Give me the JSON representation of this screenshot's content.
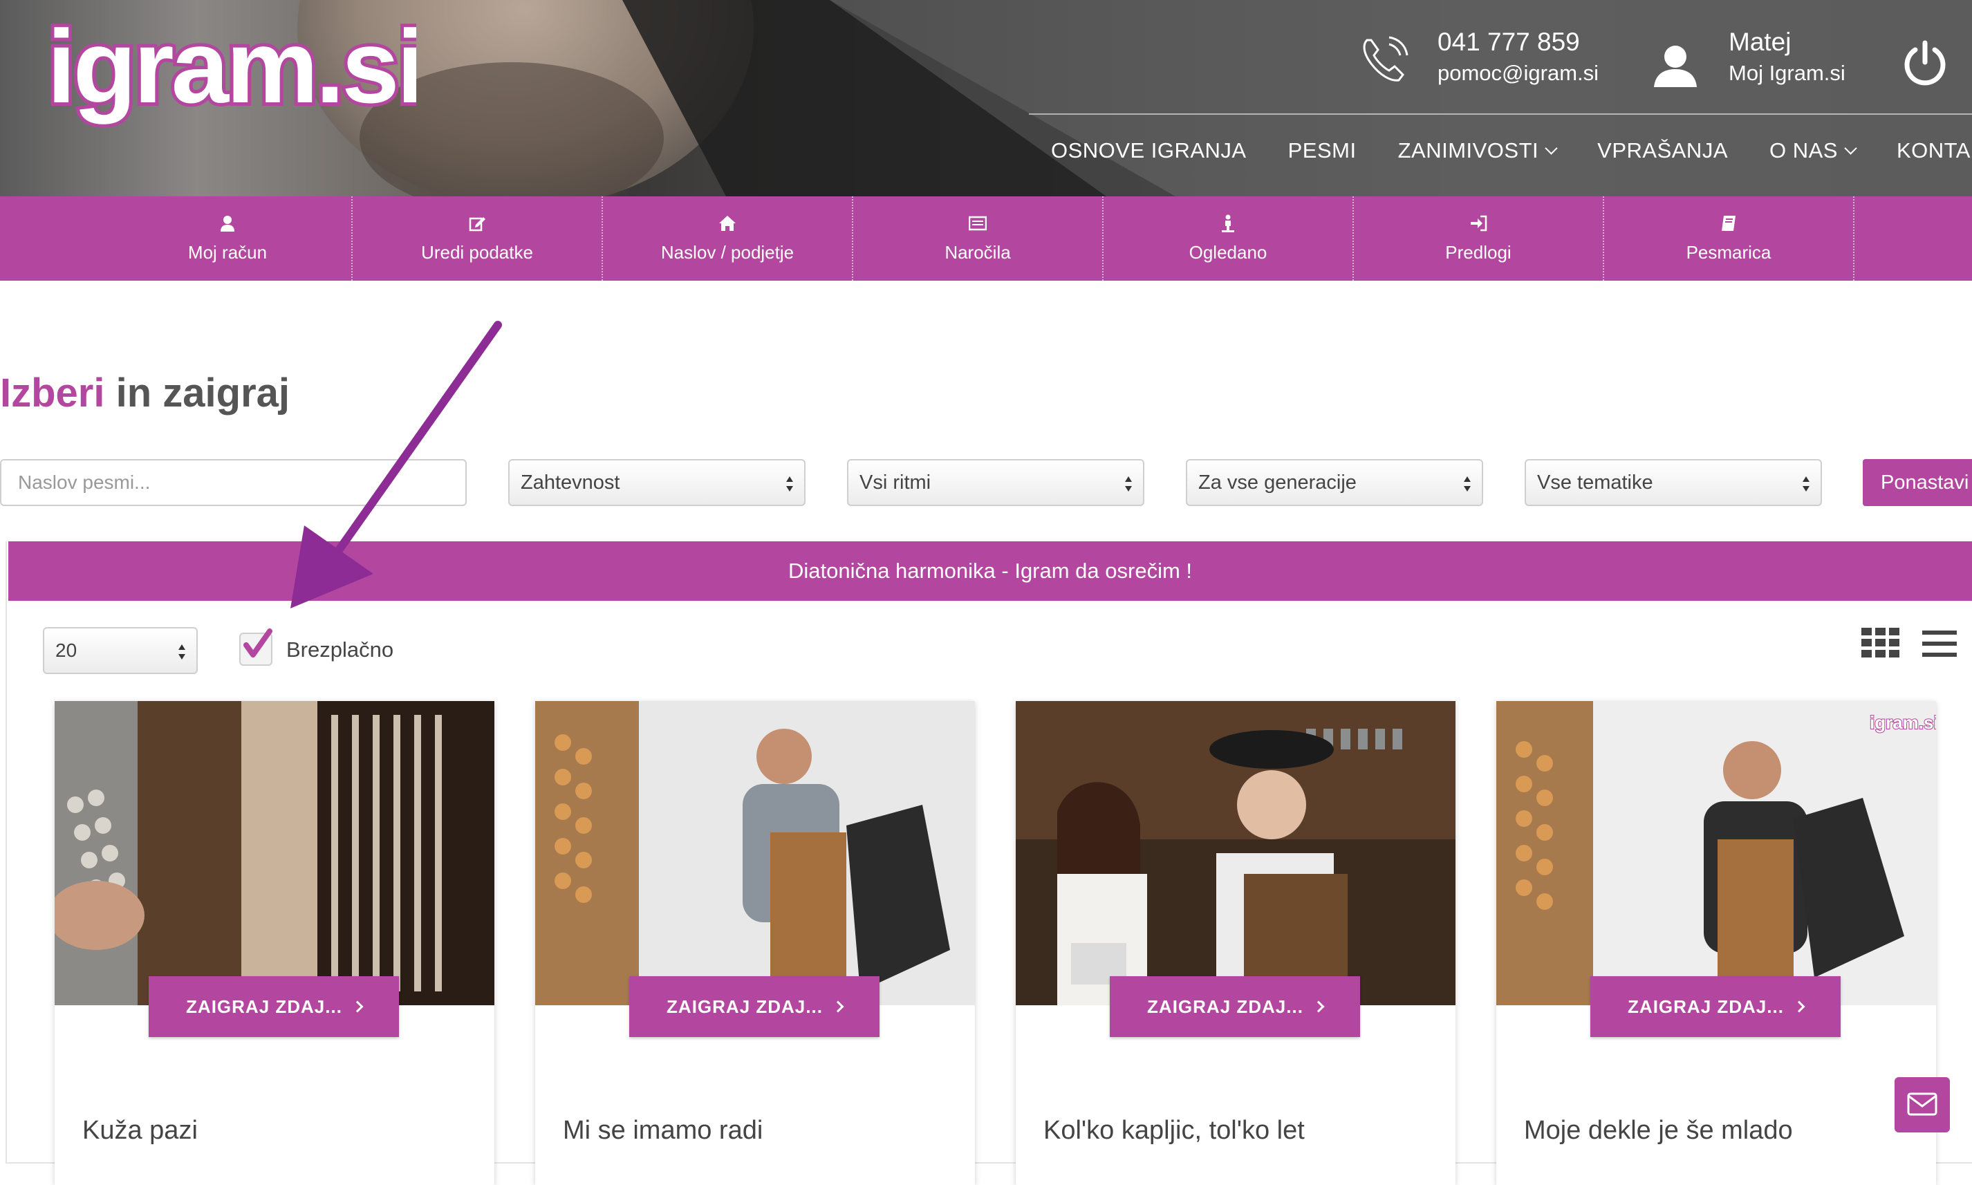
{
  "header": {
    "logo_text": "igram.si",
    "contact": {
      "phone": "041 777 859",
      "email": "pomoc@igram.si"
    },
    "user": {
      "name": "Matej",
      "account_label": "Moj Igram.si"
    },
    "nav": [
      {
        "label": "OSNOVE IGRANJA",
        "has_dropdown": false
      },
      {
        "label": "PESMI",
        "has_dropdown": false
      },
      {
        "label": "ZANIMIVOSTI",
        "has_dropdown": true
      },
      {
        "label": "VPRAŠANJA",
        "has_dropdown": false
      },
      {
        "label": "O NAS",
        "has_dropdown": true
      },
      {
        "label": "KONTAKT",
        "has_dropdown": false
      }
    ]
  },
  "account_bar": {
    "items": [
      {
        "label": "Moj račun",
        "icon": "user-icon"
      },
      {
        "label": "Uredi podatke",
        "icon": "edit-icon"
      },
      {
        "label": "Naslov / podjetje",
        "icon": "home-icon"
      },
      {
        "label": "Naročila",
        "icon": "list-icon"
      },
      {
        "label": "Ogledano",
        "icon": "person-standing-icon"
      },
      {
        "label": "Predlogi",
        "icon": "sign-in-icon"
      },
      {
        "label": "Pesmarica",
        "icon": "book-icon"
      }
    ]
  },
  "page": {
    "title_accent": "Izberi",
    "title_rest": " in zaigraj"
  },
  "filters": {
    "search_placeholder": "Naslov pesmi...",
    "difficulty": "Zahtevnost",
    "rhythm": "Vsi ritmi",
    "generation": "Za vse generacije",
    "theme": "Vse tematike",
    "reset_label": "Ponastavi"
  },
  "banner": {
    "text": "Diatonična harmonika - Igram da osrečim !"
  },
  "controls": {
    "per_page": "20",
    "free_label": "Brezplačno",
    "free_checked": true
  },
  "cards": [
    {
      "title": "Kuža pazi",
      "button": "ZAIGRAJ ZDAJ..."
    },
    {
      "title": "Mi se imamo radi",
      "button": "ZAIGRAJ ZDAJ..."
    },
    {
      "title": "Kol'ko kapljic, tol'ko let",
      "button": "ZAIGRAJ ZDAJ..."
    },
    {
      "title": "Moje dekle je še mlado",
      "button": "ZAIGRAJ ZDAJ..."
    }
  ],
  "colors": {
    "accent": "#b3479f",
    "text": "#444444"
  }
}
